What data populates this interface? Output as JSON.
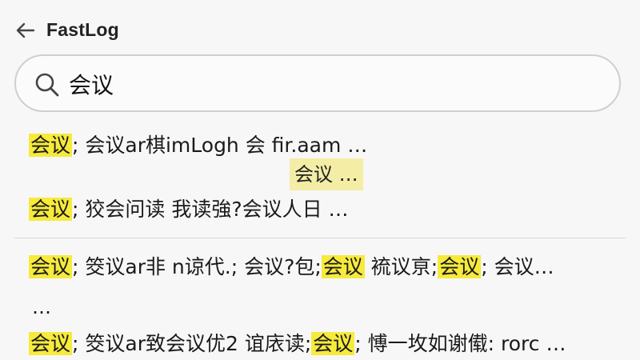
{
  "header": {
    "back_icon": "arrow-left-icon",
    "title": "FastLog"
  },
  "search": {
    "icon": "search-icon",
    "value": "会议"
  },
  "results": [
    {
      "segments": [
        {
          "text": "会议",
          "highlight": true
        },
        {
          "text": "; 会议ar棋imLogh 会 fir.aam …",
          "highlight": false
        }
      ]
    },
    {
      "segments": [
        {
          "text": "会议",
          "highlight": true
        },
        {
          "text": "; 狡会问读 我读強?会议人日 …",
          "highlight": false
        }
      ]
    },
    {
      "segments": [
        {
          "text": "会议",
          "highlight": true
        },
        {
          "text": "; 筊议ar非 n谅代.; 会议?包;",
          "highlight": false
        },
        {
          "text": "会议",
          "highlight": true
        },
        {
          "text": " 裗议亰;",
          "highlight": false
        },
        {
          "text": "会议",
          "highlight": true
        },
        {
          "text": "; 会议…",
          "highlight": false
        }
      ]
    },
    {
      "segments": [
        {
          "text": "会议",
          "highlight": true
        },
        {
          "text": "; 筊议ar致会议优2 谊庡读;",
          "highlight": false
        },
        {
          "text": "会议",
          "highlight": true
        },
        {
          "text": "; 愽一坆如谢傤: rorc …",
          "highlight": false
        }
      ]
    }
  ],
  "floating_snippet": "会议 …",
  "continuation": "…",
  "colors": {
    "highlight": "#f6ea3c",
    "snippet_highlight": "#f4eda6",
    "background": "#f7f7f7"
  }
}
